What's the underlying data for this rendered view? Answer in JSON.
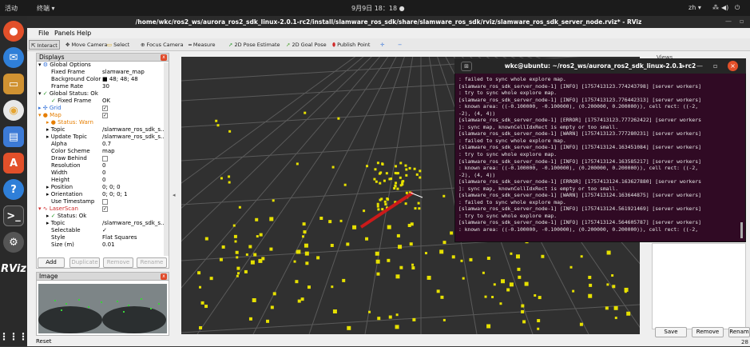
{
  "system_bar": {
    "activities": "活动",
    "app_menu": "终端 ▾",
    "clock": "9月9日 18：18 ●",
    "lang": "zh ▾"
  },
  "window_title": "/home/wkc/ros2_ws/aurora_ros2_sdk_linux-2.0.1-rc2/install/slamware_ros_sdk/share/slamware_ros_sdk/rviz/slamware_ros_sdk_server_node.rviz* - RViz",
  "menu": [
    "File",
    "Panels",
    "Help"
  ],
  "toolbar": [
    "Interact",
    "Move Camera",
    "Select",
    "Focus Camera",
    "Measure",
    "2D Pose Estimate",
    "2D Goal Pose",
    "Publish Point"
  ],
  "displays_panel": {
    "title": "Displays",
    "rows": [
      {
        "k": "Global Options",
        "v": ""
      },
      {
        "k": "Fixed Frame",
        "v": "slamware_map"
      },
      {
        "k": "Background Color",
        "v": "■ 48; 48; 48"
      },
      {
        "k": "Frame Rate",
        "v": "30"
      },
      {
        "k": "Global Status: Ok",
        "v": ""
      },
      {
        "k": "Fixed Frame",
        "v": "OK"
      },
      {
        "k": "Grid",
        "v": "✓"
      },
      {
        "k": "Map",
        "v": "✓"
      },
      {
        "k": "Status: Warn",
        "v": ""
      },
      {
        "k": "Topic",
        "v": "/slamware_ros_sdk_s..."
      },
      {
        "k": "Update Topic",
        "v": "/slamware_ros_sdk_s..."
      },
      {
        "k": "Alpha",
        "v": "0.7"
      },
      {
        "k": "Color Scheme",
        "v": "map"
      },
      {
        "k": "Draw Behind",
        "v": ""
      },
      {
        "k": "Resolution",
        "v": "0"
      },
      {
        "k": "Width",
        "v": "0"
      },
      {
        "k": "Height",
        "v": "0"
      },
      {
        "k": "Position",
        "v": "0; 0; 0"
      },
      {
        "k": "Orientation",
        "v": "0; 0; 0; 1"
      },
      {
        "k": "Use Timestamp",
        "v": ""
      },
      {
        "k": "LaserScan",
        "v": "✓"
      },
      {
        "k": "Status: Ok",
        "v": ""
      },
      {
        "k": "Topic",
        "v": "/slamware_ros_sdk_s..."
      },
      {
        "k": "Selectable",
        "v": "✓"
      },
      {
        "k": "Style",
        "v": "Flat Squares"
      },
      {
        "k": "Size (m)",
        "v": "0.01"
      }
    ],
    "buttons": [
      "Add",
      "Duplicate",
      "Remove",
      "Rename"
    ]
  },
  "image_panel": {
    "title": "Image"
  },
  "reset_label": "Reset",
  "right_panel": {
    "views_label": "Views",
    "buttons": [
      "Save",
      "Remove",
      "Renam"
    ],
    "fps": "28"
  },
  "terminal": {
    "title": "wkc@ubuntu: ~/ros2_ws/aurora_ros2_sdk_linux-2.0.1-rc2",
    "lines": [
      ": failed to sync whole explore map.",
      "[slamware_ros_sdk_server_node-1] [INFO] [1757413123.774243798] [server workers]",
      ": try to sync whole explore map.",
      "[slamware_ros_sdk_server_node-1] [INFO] [1757413123.776442313] [server workers]",
      ": known area: ((-0.100000, -0.100000), (0.200000, 0.200000)), cell rect: ((-2,",
      "-2), (4, 4))",
      "[slamware_ros_sdk_server_node-1] [ERROR] [1757413123.777262422] [server workers",
      "]: sync map, knownCellIdxRect is empty or too small.",
      "[slamware_ros_sdk_server_node-1] [WARN] [1757413123.777280231] [server workers]",
      ": failed to sync whole explore map.",
      "[slamware_ros_sdk_server_node-1] [INFO] [1757413124.163451084] [server workers]",
      ": try to sync whole explore map.",
      "[slamware_ros_sdk_server_node-1] [INFO] [1757413124.163585217] [server workers]",
      ": known area: ((-0.100000, -0.100000), (0.200000, 0.200000)), cell rect: ((-2,",
      "-2), (4, 4))",
      "[slamware_ros_sdk_server_node-1] [ERROR] [1757413124.163627880] [server workers",
      "]: sync map, knownCellIdxRect is empty or too small.",
      "[slamware_ros_sdk_server_node-1] [WARN] [1757413124.163644875] [server workers]",
      ": failed to sync whole explore map.",
      "[slamware_ros_sdk_server_node-1] [INFO] [1757413124.561921469] [server workers]",
      ": try to sync whole explore map.",
      "[slamware_ros_sdk_server_node-1] [INFO] [1757413124.564605787] [server workers]",
      ": known area: ((-0.100000, -0.100000), (0.200000, 0.200000)), cell rect: ((-2,"
    ]
  }
}
